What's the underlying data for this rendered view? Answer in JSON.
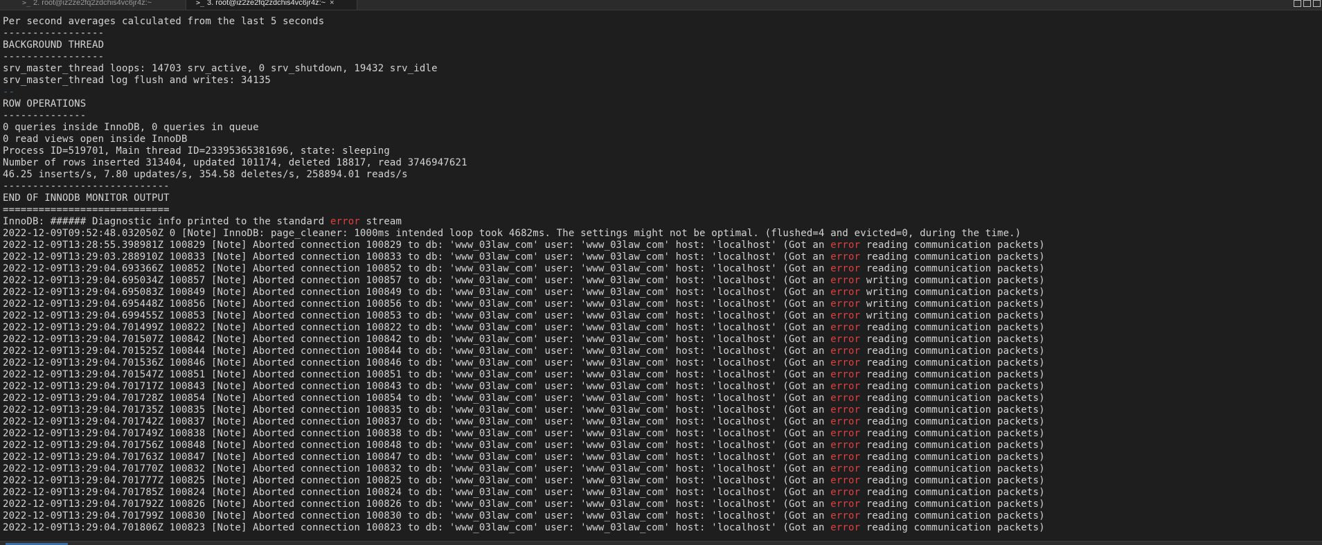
{
  "tabs": [
    {
      "label": "2. root@iz2ze2fq2zdchis4vc6jr4z:~",
      "active": false
    },
    {
      "label": "3. root@iz2ze2fq2zdchis4vc6jr4z:~",
      "active": true
    }
  ],
  "tab_close_glyph": "×",
  "prompt_glyph": ">_",
  "colors": {
    "background": "#1e1e1e",
    "text": "#d4d4d4",
    "error_word": "#e04040",
    "separator_blue": "#2f6f8f"
  },
  "header_lines": [
    "Per second averages calculated from the last 5 seconds",
    "-----------------",
    "BACKGROUND THREAD",
    "-----------------",
    "srv_master_thread loops: 14703 srv_active, 0 srv_shutdown, 19432 srv_idle",
    "srv_master_thread log flush and writes: 34135",
    "--",
    "ROW OPERATIONS",
    "--------------",
    "0 queries inside InnoDB, 0 queries in queue",
    "0 read views open inside InnoDB",
    "Process ID=519701, Main thread ID=23395365381696, state: sleeping",
    "Number of rows inserted 313404, updated 101174, deleted 18817, read 3746947621",
    "46.25 inserts/s, 7.80 updates/s, 354.58 deletes/s, 258894.01 reads/s",
    "----------------------------",
    "END OF INNODB MONITOR OUTPUT",
    "============================"
  ],
  "diagnostic": {
    "prefix": "InnoDB: ###### Diagnostic info printed to the standard ",
    "error_word": "error",
    "suffix": " stream"
  },
  "note_line": "2022-12-09T09:52:48.032050Z 0 [Note] InnoDB: page_cleaner: 1000ms intended loop took 4682ms. The settings might not be optimal. (flushed=4 and evicted=0, during the time.)",
  "aborted_template": {
    "db": "www_03law_com",
    "user": "www_03law_com",
    "host": "localhost",
    "error_word": "error"
  },
  "aborted_lines": [
    {
      "ts": "2022-12-09T13:28:55.398981Z",
      "id": "100829",
      "op": "reading"
    },
    {
      "ts": "2022-12-09T13:29:03.288910Z",
      "id": "100833",
      "op": "reading"
    },
    {
      "ts": "2022-12-09T13:29:04.693366Z",
      "id": "100852",
      "op": "reading"
    },
    {
      "ts": "2022-12-09T13:29:04.695034Z",
      "id": "100857",
      "op": "writing"
    },
    {
      "ts": "2022-12-09T13:29:04.695083Z",
      "id": "100849",
      "op": "writing"
    },
    {
      "ts": "2022-12-09T13:29:04.695448Z",
      "id": "100856",
      "op": "writing"
    },
    {
      "ts": "2022-12-09T13:29:04.699455Z",
      "id": "100853",
      "op": "writing"
    },
    {
      "ts": "2022-12-09T13:29:04.701499Z",
      "id": "100822",
      "op": "reading"
    },
    {
      "ts": "2022-12-09T13:29:04.701507Z",
      "id": "100842",
      "op": "reading"
    },
    {
      "ts": "2022-12-09T13:29:04.701525Z",
      "id": "100844",
      "op": "reading"
    },
    {
      "ts": "2022-12-09T13:29:04.701536Z",
      "id": "100846",
      "op": "reading"
    },
    {
      "ts": "2022-12-09T13:29:04.701547Z",
      "id": "100851",
      "op": "reading"
    },
    {
      "ts": "2022-12-09T13:29:04.701717Z",
      "id": "100843",
      "op": "reading"
    },
    {
      "ts": "2022-12-09T13:29:04.701728Z",
      "id": "100854",
      "op": "reading"
    },
    {
      "ts": "2022-12-09T13:29:04.701735Z",
      "id": "100835",
      "op": "reading"
    },
    {
      "ts": "2022-12-09T13:29:04.701742Z",
      "id": "100837",
      "op": "reading"
    },
    {
      "ts": "2022-12-09T13:29:04.701749Z",
      "id": "100838",
      "op": "reading"
    },
    {
      "ts": "2022-12-09T13:29:04.701756Z",
      "id": "100848",
      "op": "reading"
    },
    {
      "ts": "2022-12-09T13:29:04.701763Z",
      "id": "100847",
      "op": "reading"
    },
    {
      "ts": "2022-12-09T13:29:04.701770Z",
      "id": "100832",
      "op": "reading"
    },
    {
      "ts": "2022-12-09T13:29:04.701777Z",
      "id": "100825",
      "op": "reading"
    },
    {
      "ts": "2022-12-09T13:29:04.701785Z",
      "id": "100824",
      "op": "reading"
    },
    {
      "ts": "2022-12-09T13:29:04.701792Z",
      "id": "100826",
      "op": "reading"
    },
    {
      "ts": "2022-12-09T13:29:04.701799Z",
      "id": "100830",
      "op": "reading"
    },
    {
      "ts": "2022-12-09T13:29:04.701806Z",
      "id": "100823",
      "op": "reading"
    }
  ]
}
